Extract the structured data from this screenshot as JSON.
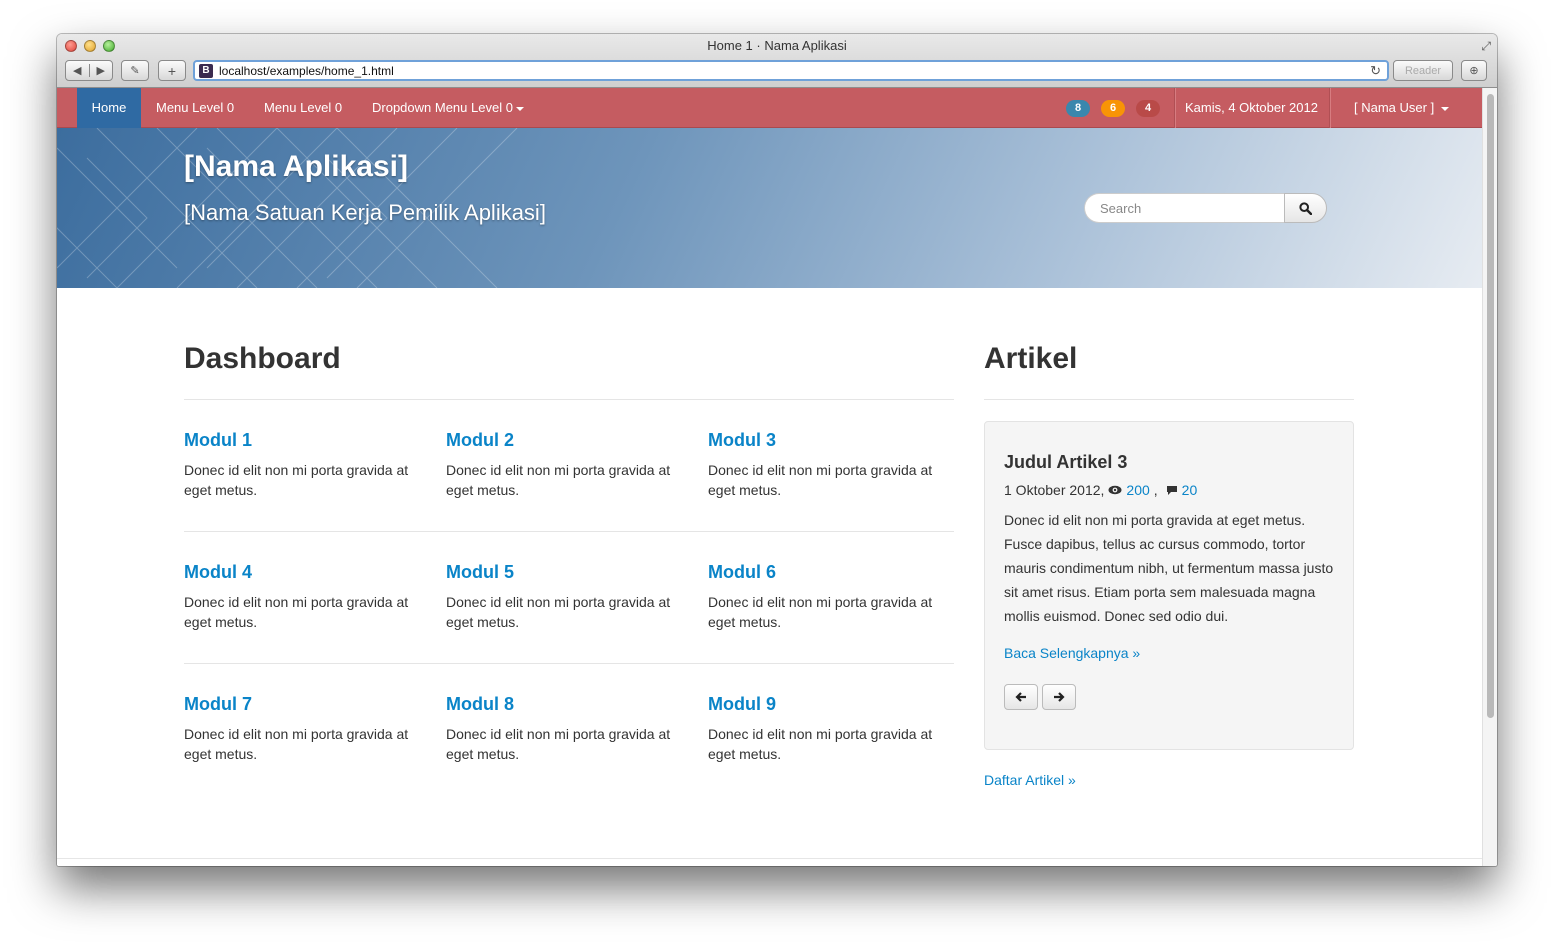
{
  "browser": {
    "window_title": "Home 1 · Nama Aplikasi",
    "url": "localhost/examples/home_1.html",
    "favicon_letter": "B",
    "reader_label": "Reader"
  },
  "nav": {
    "home": "Home",
    "menu1": "Menu Level 0",
    "menu2": "Menu Level 0",
    "dropdown": "Dropdown Menu Level 0",
    "badges": [
      {
        "value": "8",
        "color": "#3a87ad"
      },
      {
        "value": "6",
        "color": "#f89406"
      },
      {
        "value": "4",
        "color": "#b94a48"
      }
    ],
    "date": "Kamis, 4 Oktober 2012",
    "user": "[ Nama User ]"
  },
  "banner": {
    "app_name": "[Nama Aplikasi]",
    "unit_name": "[Nama Satuan Kerja Pemilik Aplikasi]",
    "search_placeholder": "Search"
  },
  "dashboard": {
    "title": "Dashboard",
    "modules": [
      {
        "title": "Modul 1",
        "text": "Donec id elit non mi porta gravida at eget metus."
      },
      {
        "title": "Modul 2",
        "text": "Donec id elit non mi porta gravida at eget metus."
      },
      {
        "title": "Modul 3",
        "text": "Donec id elit non mi porta gravida at eget metus."
      },
      {
        "title": "Modul 4",
        "text": "Donec id elit non mi porta gravida at eget metus."
      },
      {
        "title": "Modul 5",
        "text": "Donec id elit non mi porta gravida at eget metus."
      },
      {
        "title": "Modul 6",
        "text": "Donec id elit non mi porta gravida at eget metus."
      },
      {
        "title": "Modul 7",
        "text": "Donec id elit non mi porta gravida at eget metus."
      },
      {
        "title": "Modul 8",
        "text": "Donec id elit non mi porta gravida at eget metus."
      },
      {
        "title": "Modul 9",
        "text": "Donec id elit non mi porta gravida at eget metus."
      }
    ]
  },
  "artikel": {
    "title": "Artikel",
    "item_title": "Judul Artikel 3",
    "date": "1 Oktober 2012,",
    "views": "200",
    "comments": "20",
    "body": "Donec id elit non mi porta gravida at eget metus. Fusce dapibus, tellus ac cursus commodo, tortor mauris condimentum nibh, ut fermentum massa justo sit amet risus. Etiam porta sem malesuada magna mollis euismod. Donec sed odio dui.",
    "read_more": "Baca Selengkapnya »",
    "all_link": "Daftar Artikel »"
  },
  "colors": {
    "navbar": "#c55c61",
    "nav_active": "#2f6aa3",
    "link": "#0a84c8"
  }
}
